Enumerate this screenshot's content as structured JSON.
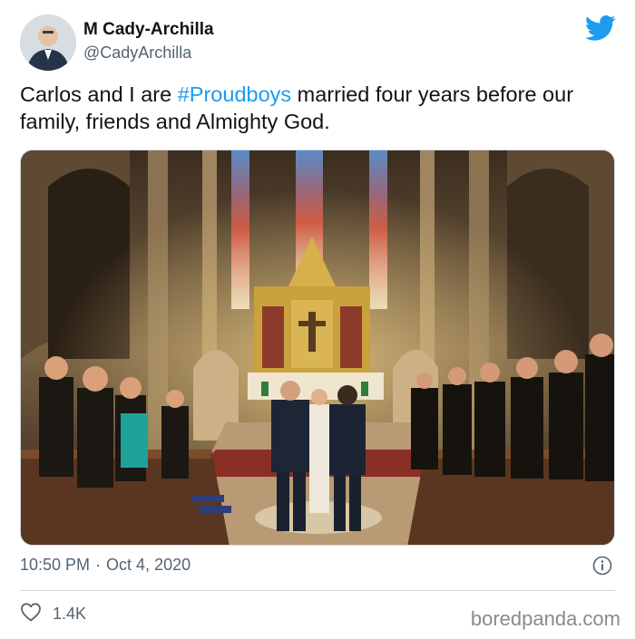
{
  "author": {
    "name": "M Cady-Archilla",
    "handle": "@CadyArchilla"
  },
  "tweet": {
    "text_before": "Carlos and I are ",
    "hashtag": "#Proudboys",
    "text_after": " married four years before our family, friends and Almighty God."
  },
  "meta": {
    "time": "10:50 PM",
    "separator": "·",
    "date": "Oct 4, 2020"
  },
  "actions": {
    "likes": "1.4K"
  },
  "watermark": "boredpanda.com",
  "icons": {
    "brand": "twitter-bird-icon",
    "like": "heart-icon",
    "info": "info-icon"
  },
  "colors": {
    "accent": "#1d9bf0",
    "text": "#0f1419",
    "secondary": "#536471"
  }
}
